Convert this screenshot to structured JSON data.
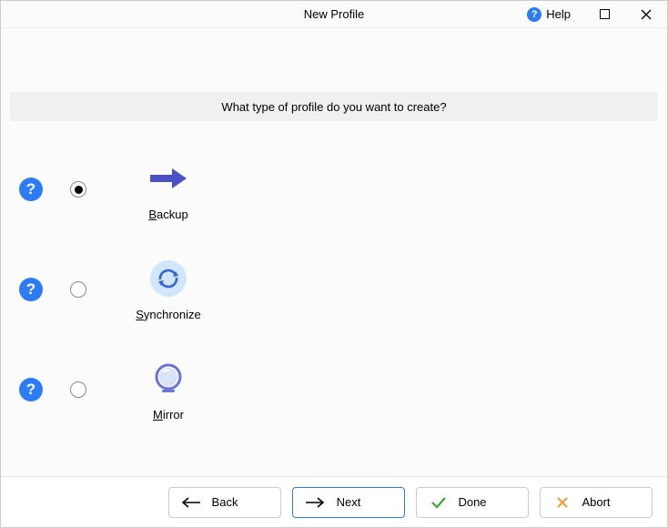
{
  "window": {
    "title": "New Profile",
    "help_label": "Help"
  },
  "question": "What type of profile do you want to create?",
  "options": [
    {
      "label": "Backup",
      "accel_index": 0,
      "selected": true,
      "icon": "arrow-right-blue"
    },
    {
      "label": "Synchronize",
      "accel_index": 0,
      "selected": false,
      "icon": "sync-blue"
    },
    {
      "label": "Mirror",
      "accel_index": 0,
      "selected": false,
      "icon": "mirror-blue"
    }
  ],
  "buttons": {
    "back": "Back",
    "next": "Next",
    "done": "Done",
    "abort": "Abort"
  },
  "colors": {
    "accent_blue": "#4a52c6",
    "button_focus": "#2c7cf5",
    "check_green": "#3ba33b",
    "abort_orange": "#e8a13c"
  }
}
